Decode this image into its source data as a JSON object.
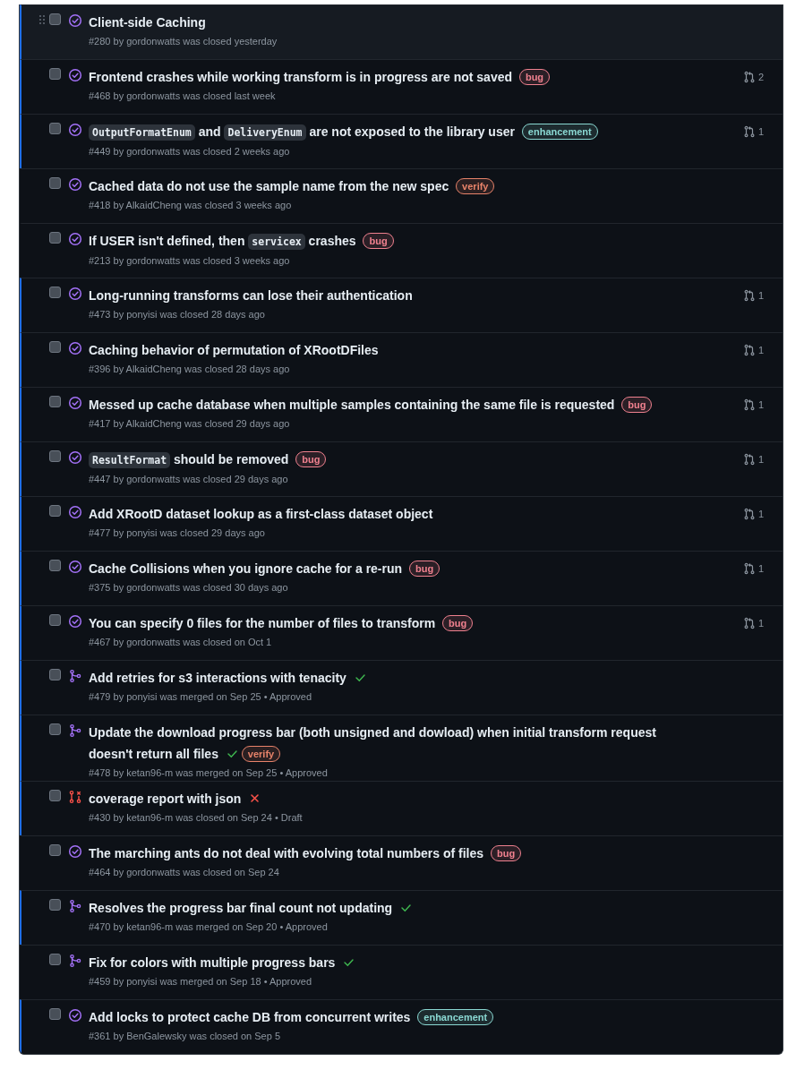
{
  "items": [
    {
      "kind": "issue_closed",
      "title": "Client-side Caching",
      "meta": "#280 by gordonwatts was closed yesterday",
      "checked": false,
      "unread": true,
      "hovered": true
    },
    {
      "kind": "issue_closed",
      "title": "Frontend crashes while working transform is in progress are not saved",
      "labels": [
        {
          "name": "bug",
          "color": "#f0818f"
        }
      ],
      "linked_prs": "2",
      "meta": "#468 by gordonwatts was closed last week",
      "checked": false,
      "unread": true,
      "hovered": false
    },
    {
      "kind": "issue_closed",
      "title_parts": [
        {
          "kind": "code",
          "text": "OutputFormatEnum"
        },
        {
          "kind": "text",
          "text": " and "
        },
        {
          "kind": "code",
          "text": "DeliveryEnum"
        },
        {
          "kind": "text",
          "text": " are not exposed to the library user"
        }
      ],
      "labels": [
        {
          "name": "enhancement",
          "color": "#8ad8d2"
        }
      ],
      "linked_prs": "1",
      "meta": "#449 by gordonwatts was closed 2 weeks ago",
      "checked": false,
      "unread": true,
      "hovered": false
    },
    {
      "kind": "issue_closed",
      "title": "Cached data do not use the sample name from the new spec",
      "labels": [
        {
          "name": "verify",
          "color": "#e8836a"
        }
      ],
      "meta": "#418 by AlkaidCheng was closed 3 weeks ago",
      "checked": false,
      "unread": false,
      "hovered": false
    },
    {
      "kind": "issue_closed",
      "title_parts": [
        {
          "kind": "text",
          "text": "If USER isn't defined, then "
        },
        {
          "kind": "code",
          "text": "servicex"
        },
        {
          "kind": "text",
          "text": " crashes"
        }
      ],
      "labels": [
        {
          "name": "bug",
          "color": "#f0818f"
        }
      ],
      "meta": "#213 by gordonwatts was closed 3 weeks ago",
      "checked": false,
      "unread": false,
      "hovered": false
    },
    {
      "kind": "issue_closed",
      "title": "Long-running transforms can lose their authentication",
      "linked_prs": "1",
      "meta": "#473 by ponyisi was closed 28 days ago",
      "checked": false,
      "unread": true,
      "hovered": false
    },
    {
      "kind": "issue_closed",
      "title": "Caching behavior of permutation of XRootDFiles",
      "linked_prs": "1",
      "meta": "#396 by AlkaidCheng was closed 28 days ago",
      "checked": false,
      "unread": true,
      "hovered": false
    },
    {
      "kind": "issue_closed",
      "title": "Messed up cache database when multiple samples containing the same file is requested",
      "labels": [
        {
          "name": "bug",
          "color": "#f0818f"
        }
      ],
      "linked_prs": "1",
      "meta": "#417 by AlkaidCheng was closed 29 days ago",
      "checked": false,
      "unread": true,
      "hovered": false
    },
    {
      "kind": "issue_closed",
      "title_parts": [
        {
          "kind": "code",
          "text": "ResultFormat"
        },
        {
          "kind": "text",
          "text": " should be removed"
        }
      ],
      "labels": [
        {
          "name": "bug",
          "color": "#f0818f"
        }
      ],
      "linked_prs": "1",
      "meta": "#447 by gordonwatts was closed 29 days ago",
      "checked": false,
      "unread": true,
      "hovered": false
    },
    {
      "kind": "issue_closed",
      "title": "Add XRootD dataset lookup as a first-class dataset object",
      "linked_prs": "1",
      "meta": "#477 by ponyisi was closed 29 days ago",
      "checked": false,
      "unread": true,
      "hovered": false
    },
    {
      "kind": "issue_closed",
      "title": "Cache Collisions when you ignore cache for a re-run",
      "labels": [
        {
          "name": "bug",
          "color": "#f0818f"
        }
      ],
      "linked_prs": "1",
      "meta": "#375 by gordonwatts was closed 30 days ago",
      "checked": false,
      "unread": true,
      "hovered": false
    },
    {
      "kind": "issue_closed",
      "title": "You can specify 0 files for the number of files to transform",
      "labels": [
        {
          "name": "bug",
          "color": "#f0818f"
        }
      ],
      "linked_prs": "1",
      "meta": "#467 by gordonwatts was closed on Oct 1",
      "checked": false,
      "unread": true,
      "hovered": false
    },
    {
      "kind": "pr_merged",
      "title": "Add retries for s3 interactions with tenacity",
      "checks_passed": true,
      "meta": "#479 by ponyisi was merged on Sep 25 • Approved",
      "checked": false,
      "unread": true,
      "hovered": false
    },
    {
      "kind": "pr_merged",
      "title": "Update the download progress bar (both unsigned and dowload) when initial transform request doesn't return all files",
      "checks_passed": true,
      "labels": [
        {
          "name": "verify",
          "color": "#e8836a"
        }
      ],
      "meta": "#478 by ketan96-m was merged on Sep 25 • Approved",
      "checked": false,
      "unread": true,
      "hovered": false
    },
    {
      "kind": "pr_closed",
      "title": "coverage report with json",
      "checks_passed": false,
      "meta": "#430 by ketan96-m was closed on Sep 24 • Draft",
      "checked": false,
      "unread": true,
      "hovered": false
    },
    {
      "kind": "issue_closed",
      "title": "The marching ants do not deal with evolving total numbers of files",
      "labels": [
        {
          "name": "bug",
          "color": "#f0818f"
        }
      ],
      "meta": "#464 by gordonwatts was closed on Sep 24",
      "checked": false,
      "unread": false,
      "hovered": false
    },
    {
      "kind": "pr_merged",
      "title": "Resolves the progress bar final count not updating",
      "checks_passed": true,
      "meta": "#470 by ketan96-m was merged on Sep 20 • Approved",
      "checked": false,
      "unread": true,
      "hovered": false
    },
    {
      "kind": "pr_merged",
      "title": "Fix for colors with multiple progress bars",
      "checks_passed": true,
      "meta": "#459 by ponyisi was merged on Sep 18 • Approved",
      "checked": false,
      "unread": false,
      "hovered": false
    },
    {
      "kind": "issue_closed",
      "title": "Add locks to protect cache DB from concurrent writes",
      "labels": [
        {
          "name": "enhancement",
          "color": "#8ad8d2"
        }
      ],
      "meta": "#361 by BenGalewsky was closed on Sep 5",
      "checked": false,
      "unread": true,
      "hovered": false
    }
  ]
}
